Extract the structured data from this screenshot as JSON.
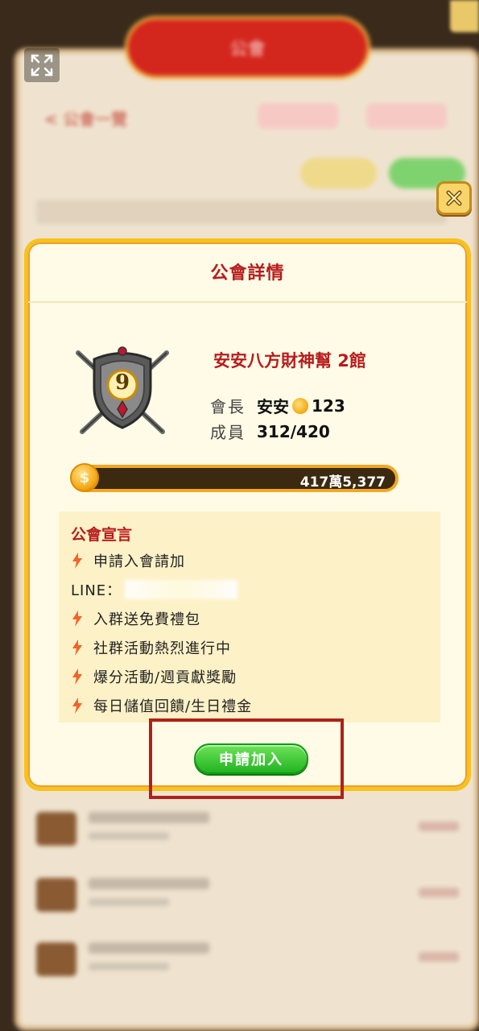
{
  "background": {
    "header_title": "公會",
    "back_label": "< 公會一覽"
  },
  "dialog": {
    "title": "公會詳情",
    "guild": {
      "name": "安安八方財神幫 2館",
      "leader_label": "會長",
      "leader_name": "安安",
      "leader_level": "123",
      "members_label": "成員",
      "members_value": "312/420",
      "emblem_level": "9",
      "fund_display": "417萬5,377"
    },
    "declaration": {
      "title": "公會宣言",
      "lines": [
        "申請入會請加",
        "LINE：",
        "入群送免費禮包",
        "社群活動熱烈進行中",
        "爆分活動/週貢獻獎勵",
        "每日儲值回饋/生日禮金"
      ]
    },
    "apply_label": "申請加入"
  },
  "icons": {
    "close": "close-icon",
    "expand": "expand-icon",
    "bolt": "lightning-bolt-icon",
    "coin": "coin-icon"
  },
  "colors": {
    "title_red": "#b71c1c",
    "border_gold": "#f6c21c",
    "apply_green": "#21b421",
    "highlight_red": "#b0201a"
  }
}
